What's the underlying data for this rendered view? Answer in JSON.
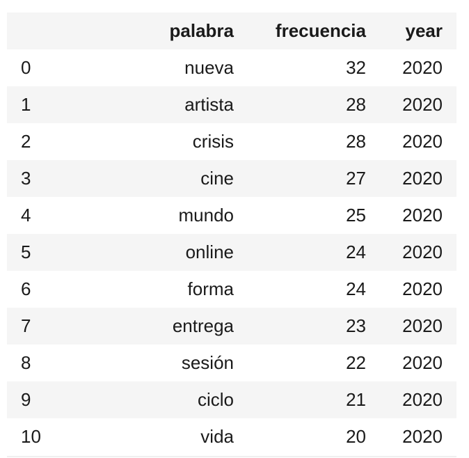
{
  "table": {
    "columns": {
      "index": "",
      "palabra": "palabra",
      "frecuencia": "frecuencia",
      "year": "year"
    },
    "rows": [
      {
        "index": "0",
        "palabra": "nueva",
        "frecuencia": "32",
        "year": "2020"
      },
      {
        "index": "1",
        "palabra": "artista",
        "frecuencia": "28",
        "year": "2020"
      },
      {
        "index": "2",
        "palabra": "crisis",
        "frecuencia": "28",
        "year": "2020"
      },
      {
        "index": "3",
        "palabra": "cine",
        "frecuencia": "27",
        "year": "2020"
      },
      {
        "index": "4",
        "palabra": "mundo",
        "frecuencia": "25",
        "year": "2020"
      },
      {
        "index": "5",
        "palabra": "online",
        "frecuencia": "24",
        "year": "2020"
      },
      {
        "index": "6",
        "palabra": "forma",
        "frecuencia": "24",
        "year": "2020"
      },
      {
        "index": "7",
        "palabra": "entrega",
        "frecuencia": "23",
        "year": "2020"
      },
      {
        "index": "8",
        "palabra": "sesión",
        "frecuencia": "22",
        "year": "2020"
      },
      {
        "index": "9",
        "palabra": "ciclo",
        "frecuencia": "21",
        "year": "2020"
      },
      {
        "index": "10",
        "palabra": "vida",
        "frecuencia": "20",
        "year": "2020"
      }
    ]
  }
}
